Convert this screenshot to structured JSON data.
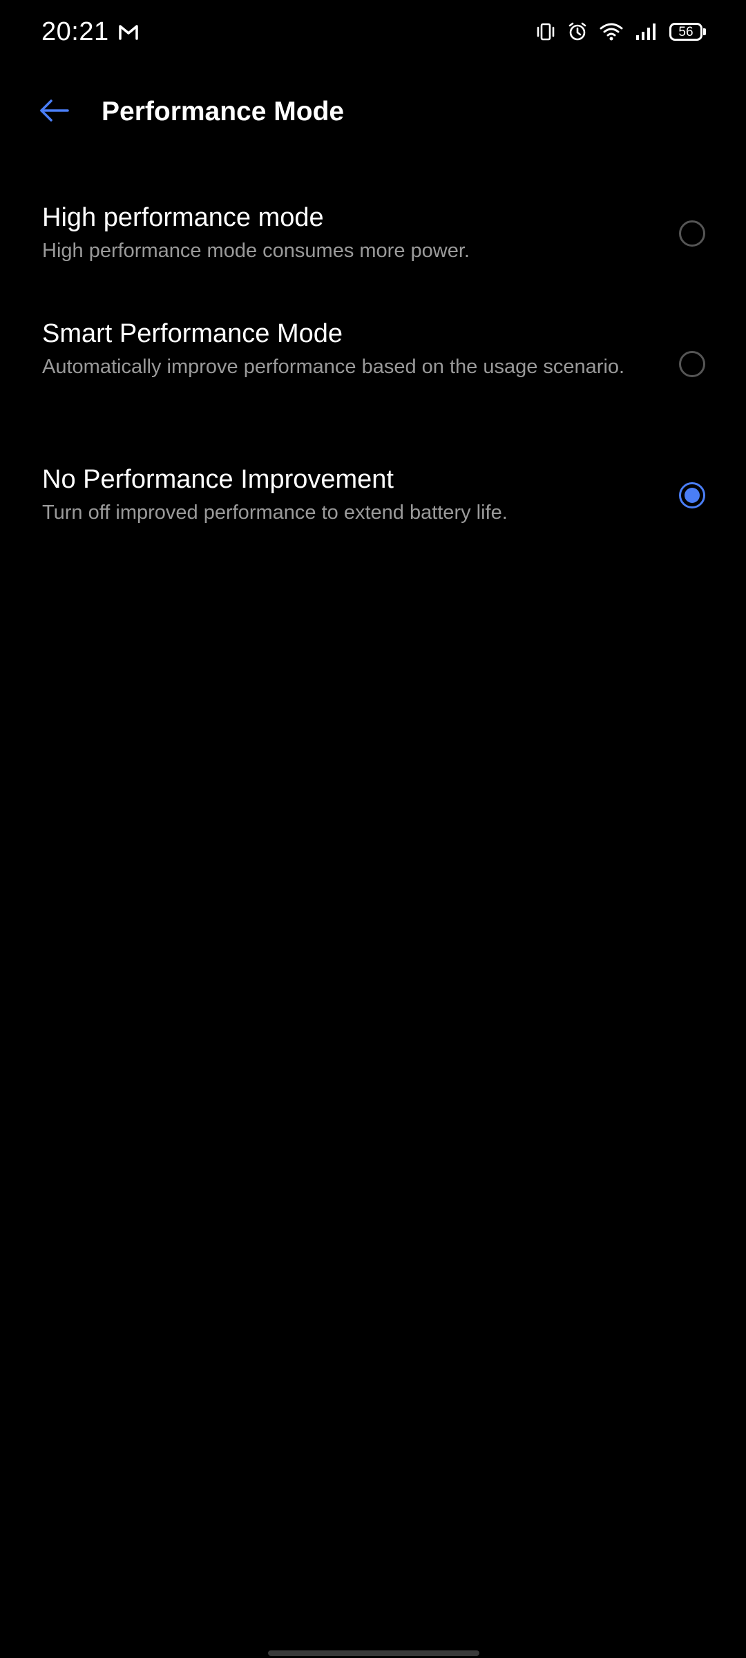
{
  "status_bar": {
    "time": "20:21",
    "battery_level": "56",
    "icons": [
      "gmail-icon",
      "vibrate-icon",
      "alarm-icon",
      "wifi-icon",
      "signal-icon",
      "battery-icon"
    ]
  },
  "header": {
    "title": "Performance Mode",
    "back_icon": "back-arrow-icon"
  },
  "options": [
    {
      "title": "High performance mode",
      "description": "High performance mode consumes more power.",
      "selected": false
    },
    {
      "title": "Smart Performance Mode",
      "description": "Automatically improve performance based on the usage scenario.",
      "selected": false
    },
    {
      "title": "No Performance Improvement",
      "description": "Turn off improved performance to extend battery life.",
      "selected": true
    }
  ],
  "colors": {
    "background": "#000000",
    "accent": "#4a7ef6",
    "secondary_text": "#9a9a9a",
    "radio_unchecked": "#555555"
  }
}
